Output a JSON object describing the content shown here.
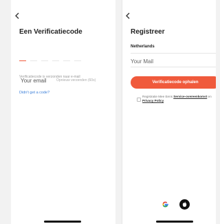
{
  "left_screen": {
    "title": "Een Verificatiecode",
    "code_slot_count": 6,
    "sent_note": "Verificatiecode is verzonden naar e-mail",
    "email_label": "Your email",
    "resend_label": "Opnieuw verzenden (60s)",
    "no_code_link": "Didn't get a code?"
  },
  "right_screen": {
    "title": "Registreer",
    "country_value": "Netherlands",
    "mail_placeholder": "Your Mail",
    "get_code_button": "Verificatiecode ophalen",
    "agreement": {
      "prefix": "Registratie Mee Eens ",
      "service_link": "Service-overeenkomst",
      "conjunction": " en ",
      "privacy_link": "Privacy Policy",
      "suffix": "."
    }
  },
  "colors": {
    "accent": "#f05a3c",
    "link": "#3b7fd9"
  }
}
